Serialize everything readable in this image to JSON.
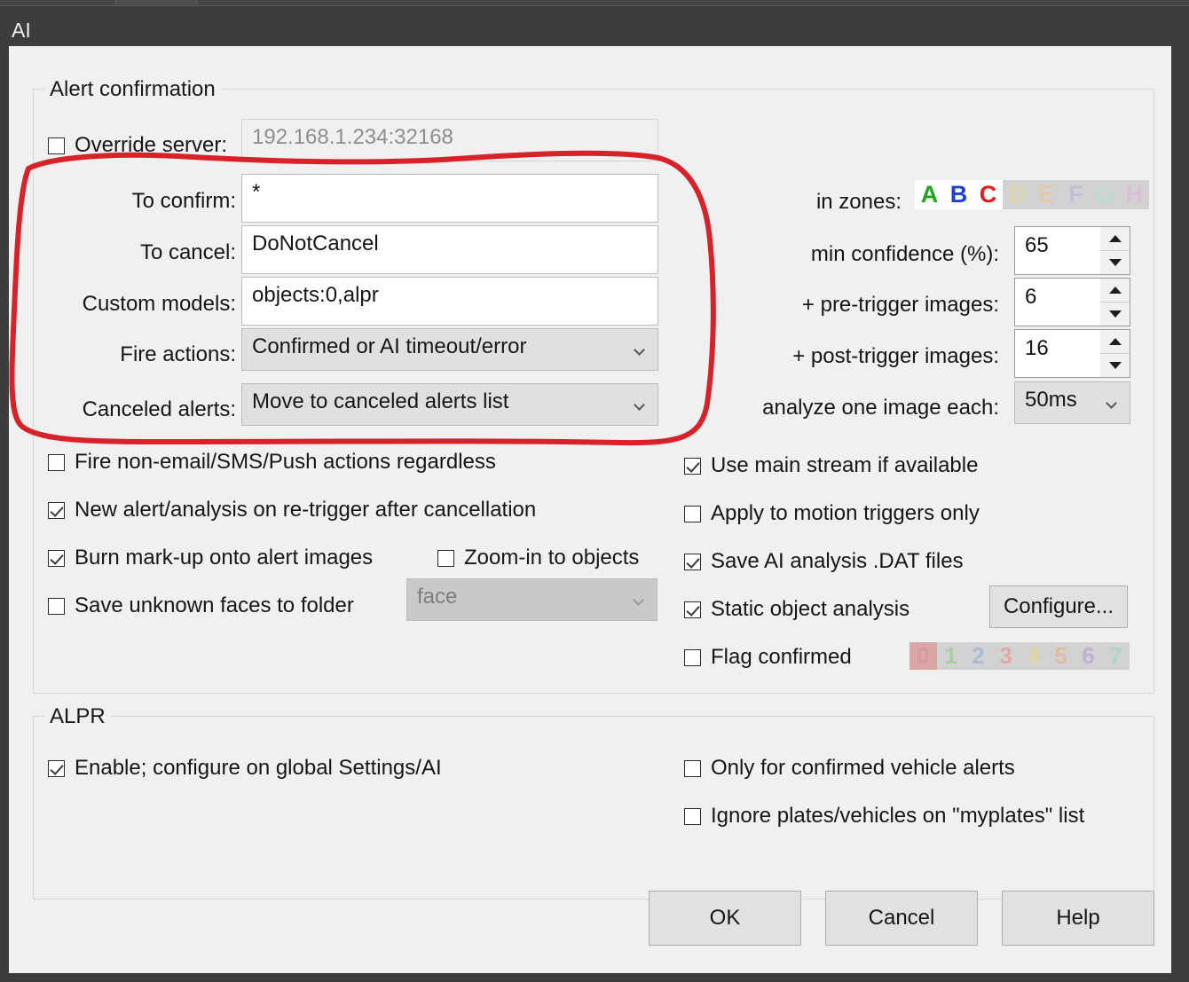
{
  "window": {
    "title": "AI"
  },
  "groups": {
    "alert_confirmation": "Alert confirmation",
    "alpr": "ALPR"
  },
  "alert_confirmation": {
    "override_server": {
      "label": "Override server:",
      "checked": false,
      "value": "192.168.1.234:32168",
      "enabled": false
    },
    "to_confirm": {
      "label": "To confirm:",
      "value": "*"
    },
    "to_cancel": {
      "label": "To cancel:",
      "value": "DoNotCancel"
    },
    "custom_models": {
      "label": "Custom models:",
      "value": "objects:0,alpr"
    },
    "fire_actions": {
      "label": "Fire actions:",
      "value": "Confirmed or AI timeout/error"
    },
    "canceled_alerts": {
      "label": "Canceled alerts:",
      "value": "Move to canceled alerts list"
    },
    "in_zones": {
      "label": "in zones:",
      "zones": [
        {
          "letter": "A",
          "active": true,
          "color": "#22a322"
        },
        {
          "letter": "B",
          "active": true,
          "color": "#1b3fd8"
        },
        {
          "letter": "C",
          "active": true,
          "color": "#e21b1b"
        },
        {
          "letter": "D",
          "active": false,
          "color": "#ded5a8"
        },
        {
          "letter": "E",
          "active": false,
          "color": "#e2c9ad"
        },
        {
          "letter": "F",
          "active": false,
          "color": "#c1c0d6"
        },
        {
          "letter": "G",
          "active": false,
          "color": "#bcdcd0"
        },
        {
          "letter": "H",
          "active": false,
          "color": "#debcd4"
        }
      ]
    },
    "min_confidence": {
      "label": "min confidence (%):",
      "value": "65"
    },
    "pre_trigger_images": {
      "label": "+ pre-trigger images:",
      "value": "6"
    },
    "post_trigger_images": {
      "label": "+ post-trigger images:",
      "value": "16"
    },
    "analyze_each": {
      "label": "analyze one image each:",
      "value": "50ms"
    },
    "checkboxes_left": [
      {
        "label": "Fire non-email/SMS/Push actions regardless",
        "checked": false
      },
      {
        "label": "New alert/analysis on re-trigger after cancellation",
        "checked": true
      },
      {
        "label": "Burn mark-up onto alert images",
        "checked": true
      },
      {
        "label": "Save unknown faces to folder",
        "checked": false
      }
    ],
    "zoom_in_to_objects": {
      "label": "Zoom-in to objects",
      "checked": false
    },
    "faces_folder": {
      "value": "face",
      "enabled": false
    },
    "checkboxes_right": [
      {
        "label": "Use main stream if available",
        "checked": true
      },
      {
        "label": "Apply to motion triggers only",
        "checked": false
      },
      {
        "label": "Save AI analysis .DAT files",
        "checked": true
      },
      {
        "label": "Static object analysis",
        "checked": true
      },
      {
        "label": "Flag confirmed",
        "checked": false
      }
    ],
    "configure_button": "Configure...",
    "flag_numbers": [
      {
        "digit": "0",
        "color": "#d99a9a",
        "bg": "#dba6a6"
      },
      {
        "digit": "1",
        "color": "#a7cfa0",
        "bg": "#d2d2d2"
      },
      {
        "digit": "2",
        "color": "#a7bcd6",
        "bg": "#d2d2d2"
      },
      {
        "digit": "3",
        "color": "#dfa9a5",
        "bg": "#d2d2d2"
      },
      {
        "digit": "4",
        "color": "#ddd5a0",
        "bg": "#d2d2d2"
      },
      {
        "digit": "5",
        "color": "#e0bba1",
        "bg": "#d2d2d2"
      },
      {
        "digit": "6",
        "color": "#c2aed4",
        "bg": "#d2d2d2"
      },
      {
        "digit": "7",
        "color": "#a7d7cb",
        "bg": "#d2d2d2"
      }
    ]
  },
  "alpr": {
    "enable": {
      "label": "Enable; configure on global Settings/AI",
      "checked": true
    },
    "only_confirmed": {
      "label": "Only for confirmed vehicle alerts",
      "checked": false
    },
    "ignore_myplates": {
      "label": "Ignore plates/vehicles on \"myplates\" list",
      "checked": false
    }
  },
  "footer": {
    "ok": "OK",
    "cancel": "Cancel",
    "help": "Help"
  },
  "annotation": {
    "color": "#d6232a",
    "stroke_width": 6
  }
}
